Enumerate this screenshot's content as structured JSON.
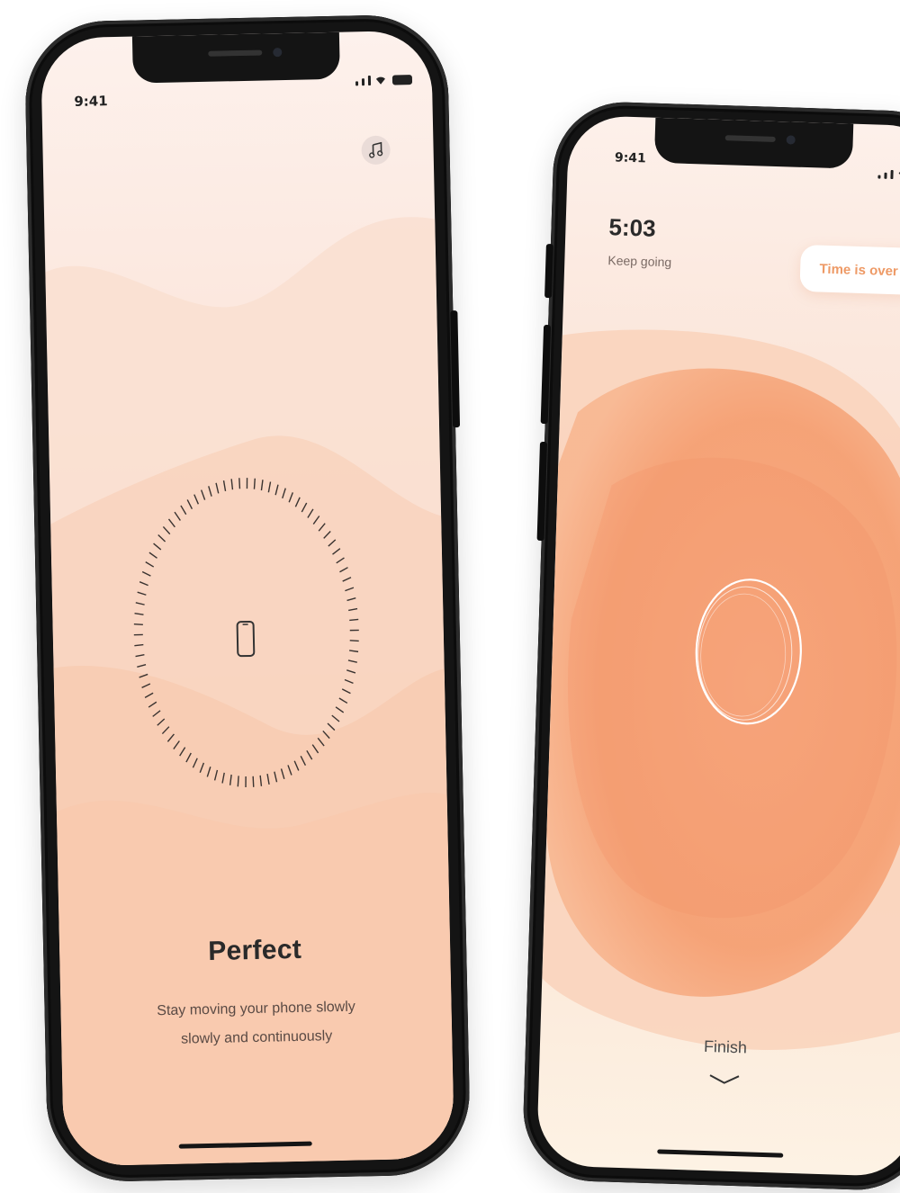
{
  "left_phone": {
    "status_time": "9:41",
    "music_icon": "music-note-icon",
    "title": "Perfect",
    "subtitle_line1": "Stay moving your phone slowly",
    "subtitle_line2": "slowly and continuously",
    "center_icon": "phone-outline-icon"
  },
  "right_phone": {
    "status_time": "9:41",
    "timer": "5:03",
    "timer_caption": "Keep going",
    "time_over_label": "Time is over",
    "finish_label": "Finish",
    "finish_icon": "chevron-down-icon"
  },
  "colors": {
    "peach_light": "#fcebe3",
    "peach": "#f9c9ad",
    "peach_deep": "#f59a6c",
    "accent_orange": "#ee9a66",
    "frame": "#141414"
  }
}
